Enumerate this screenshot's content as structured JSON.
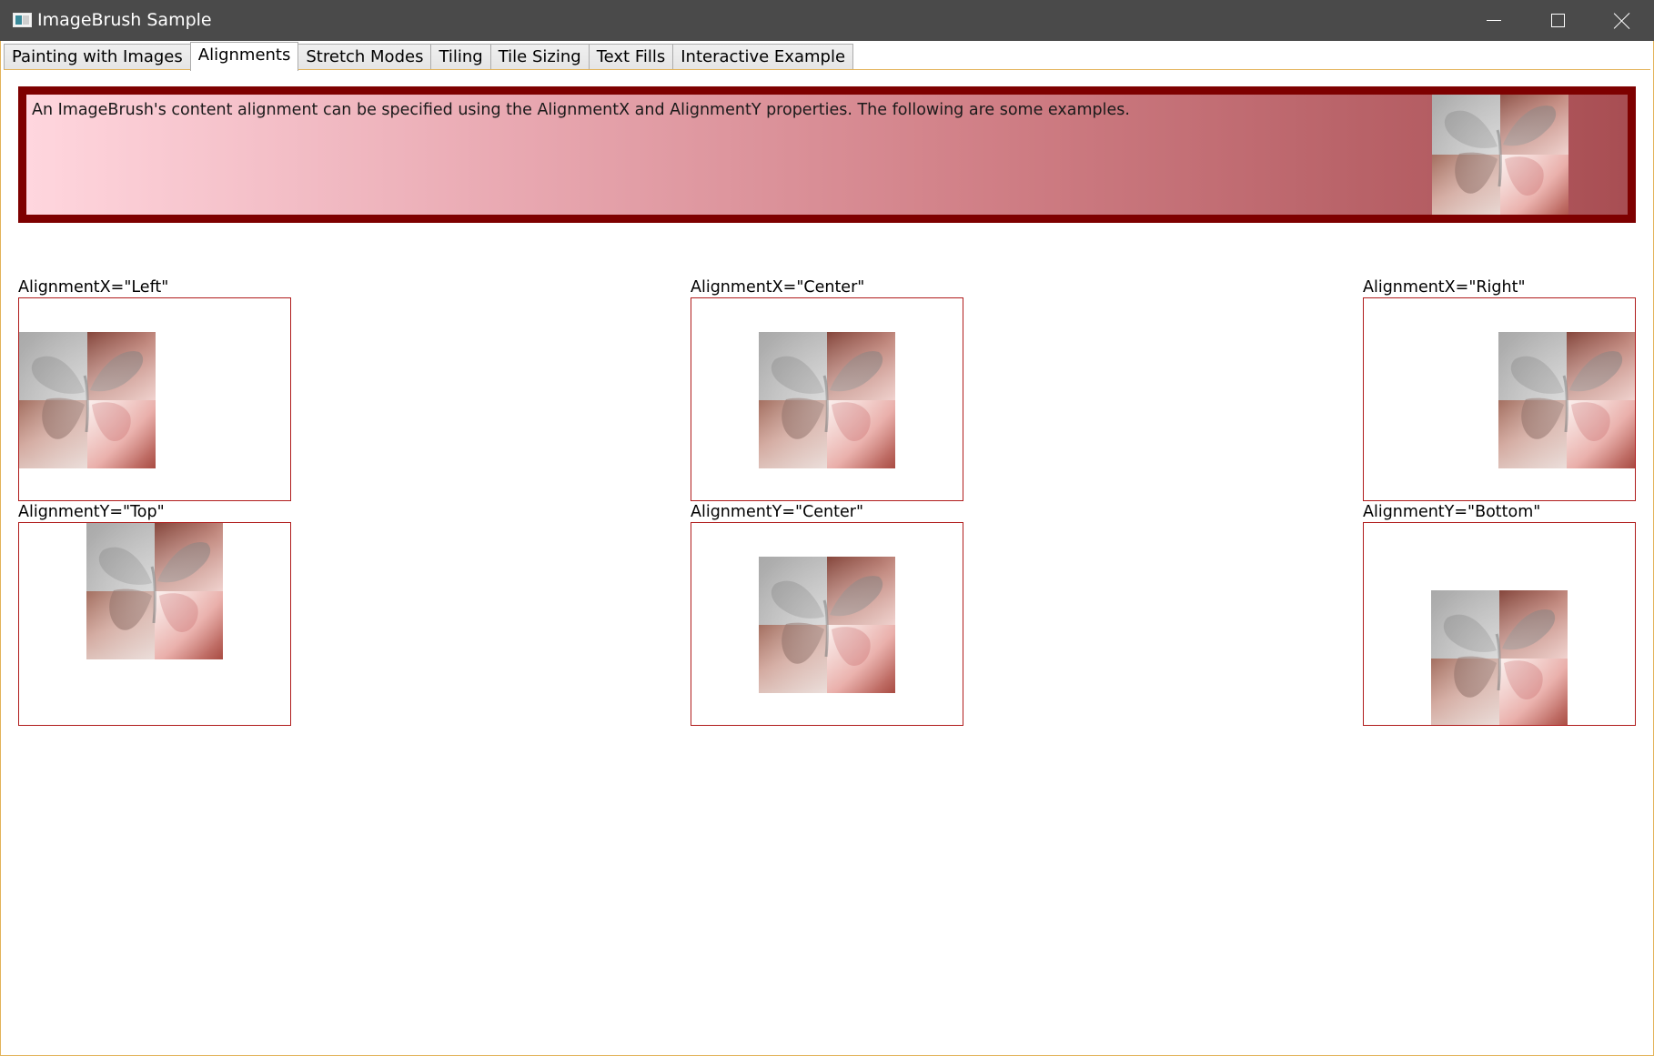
{
  "window": {
    "title": "ImageBrush Sample"
  },
  "tabs": [
    {
      "label": "Painting with Images",
      "active": false
    },
    {
      "label": "Alignments",
      "active": true
    },
    {
      "label": "Stretch Modes",
      "active": false
    },
    {
      "label": "Tiling",
      "active": false
    },
    {
      "label": "Tile Sizing",
      "active": false
    },
    {
      "label": "Text Fills",
      "active": false
    },
    {
      "label": "Interactive Example",
      "active": false
    }
  ],
  "banner": {
    "text": "An ImageBrush's content alignment can be specified using the AlignmentX and AlignmentY properties. The following are some examples.",
    "border_color": "#7e0000"
  },
  "examples": [
    {
      "label": "AlignmentX=\"Left\"",
      "icon": "butterfly-image"
    },
    {
      "label": "AlignmentX=\"Center\"",
      "icon": "butterfly-image"
    },
    {
      "label": "AlignmentX=\"Right\"",
      "icon": "butterfly-image"
    },
    {
      "label": "AlignmentY=\"Top\"",
      "icon": "butterfly-image"
    },
    {
      "label": "AlignmentY=\"Center\"",
      "icon": "butterfly-image"
    },
    {
      "label": "AlignmentY=\"Bottom\"",
      "icon": "butterfly-image"
    }
  ],
  "colors": {
    "title_bar": "#4a4a4a",
    "box_border": "#b01c1c",
    "frame_accent": "#e3b35a"
  }
}
